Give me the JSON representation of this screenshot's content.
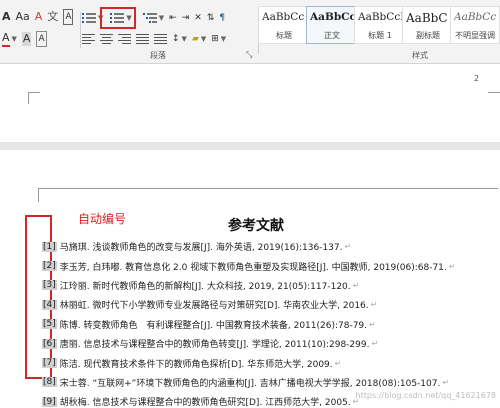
{
  "ribbon": {
    "font_group": {
      "row1": [
        "A",
        "Aa",
        "A"
      ],
      "row2": [
        "A",
        "A",
        "A"
      ]
    },
    "paragraph_label": "段落",
    "styles_label": "样式",
    "styles": [
      {
        "sample": "AaBbCc",
        "name": "标题"
      },
      {
        "sample": "AaBbCc",
        "name": "正文"
      },
      {
        "sample": "AaBbCcI",
        "name": "标题 1"
      },
      {
        "sample": "AaBbC",
        "name": "副标题"
      },
      {
        "sample": "AaBbCc",
        "name": "不明显强调"
      }
    ],
    "icons": {
      "bullets": "bullet-list-icon",
      "numbering": "numbered-list-icon",
      "multilevel": "multilevel-list-icon"
    }
  },
  "page1": {
    "page_number": "2"
  },
  "page2": {
    "title": "参考文献",
    "annotation": "自动编号",
    "references": [
      {
        "num": "[1]",
        "text": "马旖琪. 浅谈教师角色的改变与发展[J]. 海外英语, 2019(16):136-137."
      },
      {
        "num": "[2]",
        "text": "李玉芳, 白玮嘟. 教育信息化 2.0 视域下教师角色重塑及实现路径[J]. 中国教师, 2019(06):68-71."
      },
      {
        "num": "[3]",
        "text": "江玲丽. 新时代教师角色的新解构[J]. 大众科技, 2019, 21(05):117-120."
      },
      {
        "num": "[4]",
        "text": "林丽虹. 微时代下小学教师专业发展路径与对策研究[D]. 华南农业大学, 2016."
      },
      {
        "num": "[5]",
        "text": "陈博. 转变教师角色　有利课程整合[J]. 中国教育技术装备, 2011(26):78-79."
      },
      {
        "num": "[6]",
        "text": "唐丽. 信息技术与课程整合中的教师角色转变[J]. 学理论, 2011(10):298-299."
      },
      {
        "num": "[7]",
        "text": "陈洁. 现代教育技术条件下的教师角色探析[D]. 华东师范大学, 2009."
      },
      {
        "num": "[8]",
        "text": "宋士蓉. “互联网+”环境下教师角色的内涵重构[J]. 吉林广播电视大学学报, 2018(08):105-107."
      },
      {
        "num": "[9]",
        "text": "胡秋梅. 信息技术与课程整合中的教师角色研究[D]. 江西师范大学, 2005."
      }
    ],
    "return_mark": "↵",
    "watermark": "https://blog.csdn.net/qq_41621678"
  },
  "colors": {
    "highlight_box": "#d32626",
    "annotation": "#e02020"
  }
}
